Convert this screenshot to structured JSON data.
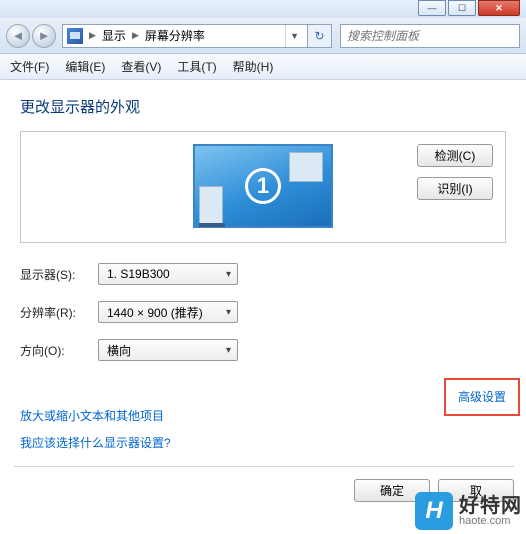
{
  "titlebar": {
    "min": "—",
    "max": "☐",
    "close": "✕"
  },
  "nav": {
    "back": "◄",
    "forward": "►",
    "crumb1": "显示",
    "crumb2": "屏幕分辨率",
    "refresh": "↻",
    "search_placeholder": "搜索控制面板"
  },
  "menu": {
    "file": "文件(F)",
    "edit": "编辑(E)",
    "view": "查看(V)",
    "tools": "工具(T)",
    "help": "帮助(H)"
  },
  "heading": "更改显示器的外观",
  "preview": {
    "number": "1"
  },
  "buttons": {
    "detect": "检测(C)",
    "identify": "识别(I)"
  },
  "form": {
    "display_label": "显示器(S):",
    "display_value": "1. S19B300",
    "res_label": "分辨率(R):",
    "res_value": "1440 × 900 (推荐)",
    "orient_label": "方向(O):",
    "orient_value": "横向"
  },
  "links": {
    "advanced": "高级设置",
    "textsize": "放大或缩小文本和其他项目",
    "whichsetting": "我应该选择什么显示器设置?"
  },
  "footer": {
    "ok": "确定",
    "cancel": "取"
  },
  "watermark": {
    "badge": "H",
    "cn": "好特网",
    "en": "haote.com"
  }
}
